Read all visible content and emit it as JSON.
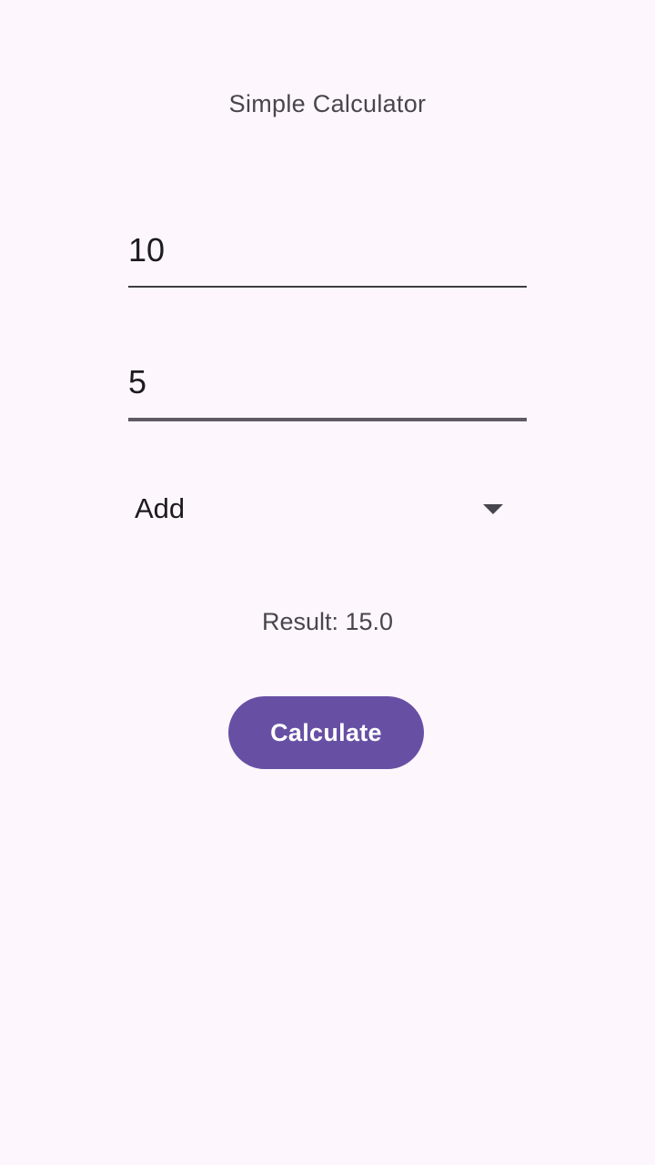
{
  "app": {
    "title": "Simple Calculator"
  },
  "inputs": {
    "first_value": "10",
    "second_value": "5"
  },
  "operation": {
    "selected": "Add",
    "icon": "arrow-drop-down-icon"
  },
  "result": {
    "text": "Result: 15.0"
  },
  "actions": {
    "calculate_label": "Calculate"
  },
  "colors": {
    "background": "#FDF7FD",
    "primary": "#6750A4",
    "on_surface": "#1D1B20",
    "on_surface_variant": "#49454F"
  }
}
